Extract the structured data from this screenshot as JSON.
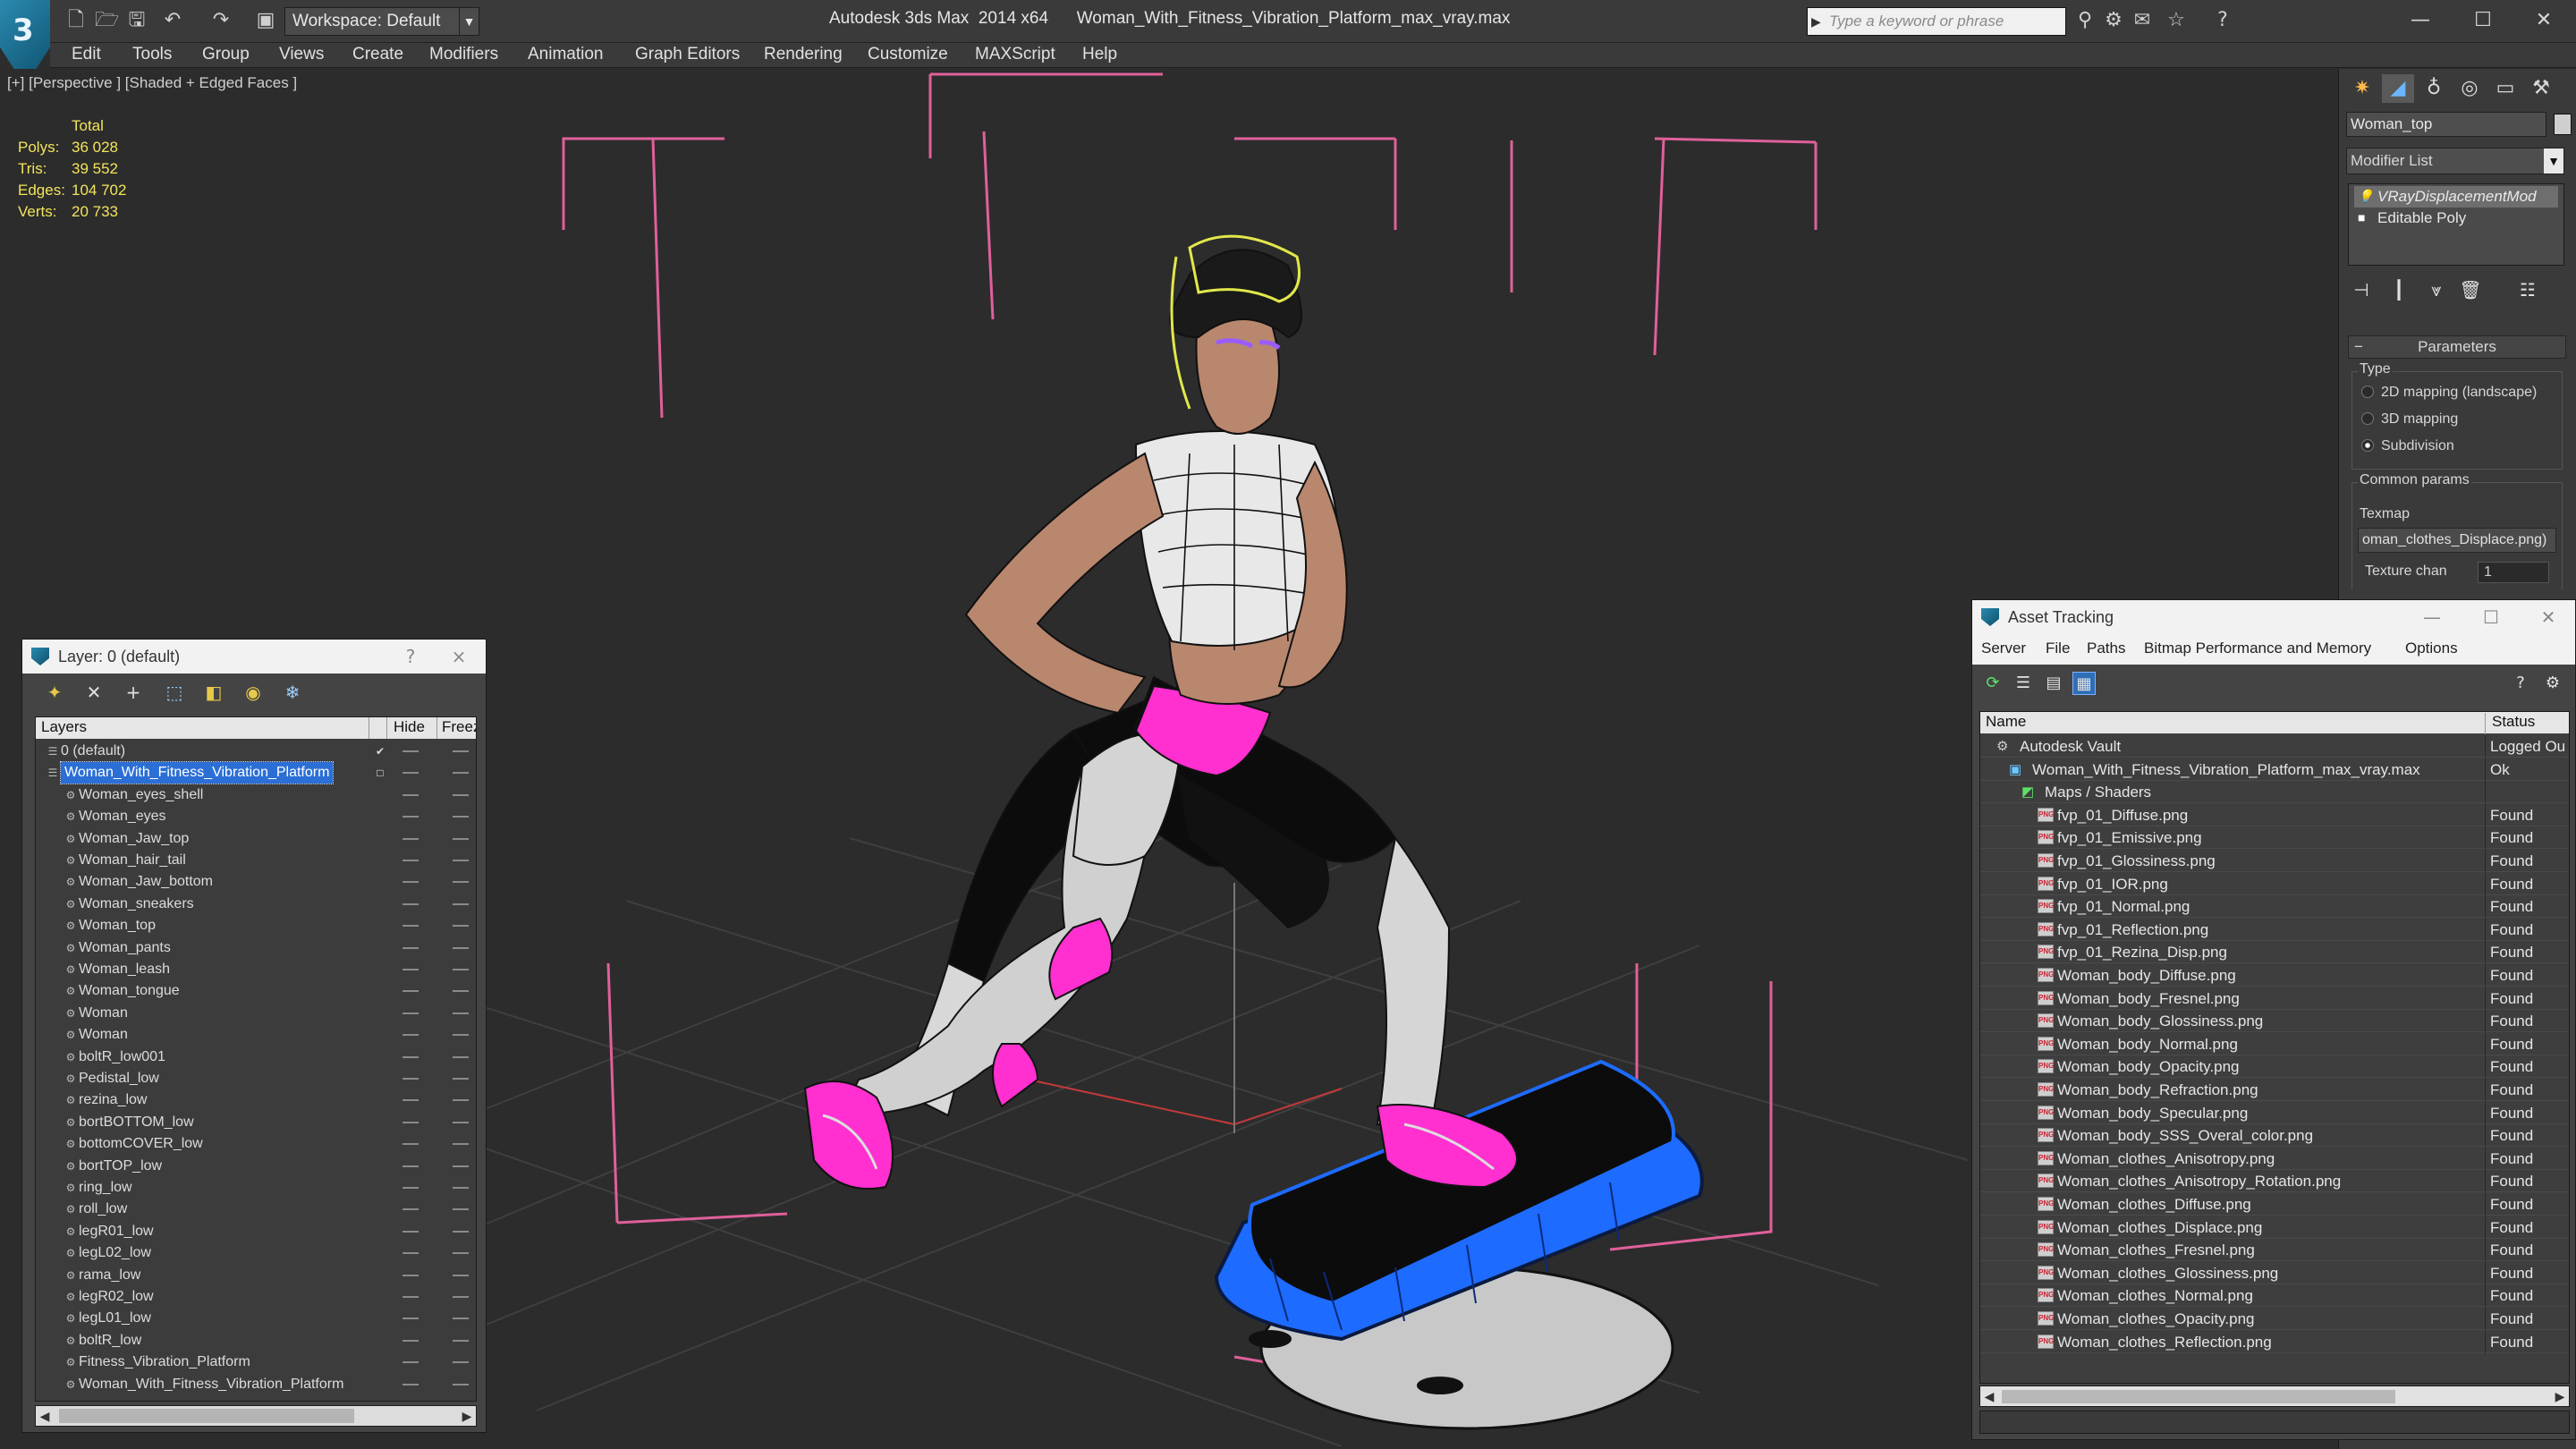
{
  "titlebar": {
    "workspace_label": "Workspace: Default",
    "app_title": "Autodesk 3ds Max  2014 x64      Woman_With_Fitness_Vibration_Platform_max_vray.max",
    "search_placeholder": "Type a keyword or phrase"
  },
  "menu": [
    "Edit",
    "Tools",
    "Group",
    "Views",
    "Create",
    "Modifiers",
    "Animation",
    "Graph Editors",
    "Rendering",
    "Customize",
    "MAXScript",
    "Help"
  ],
  "viewport": {
    "label": "[+] [Perspective ] [Shaded + Edged Faces ]",
    "stats": {
      "header": "Total",
      "polys_label": "Polys:",
      "polys": "36 028",
      "tris_label": "Tris:",
      "tris": "39 552",
      "edges_label": "Edges:",
      "edges": "104 702",
      "verts_label": "Verts:",
      "verts": "20 733"
    }
  },
  "command_panel": {
    "object_name": "Woman_top",
    "modifier_list": "Modifier List",
    "stack": [
      "VRayDisplacementMod",
      "Editable Poly"
    ],
    "parameters_title": "Parameters",
    "type_group": "Type",
    "type_options": [
      "2D mapping (landscape)",
      "3D mapping",
      "Subdivision"
    ],
    "type_selected": 2,
    "common_group": "Common params",
    "texmap_label": "Texmap",
    "texmap_value": "oman_clothes_Displace.png)",
    "texture_chan_label": "Texture chan",
    "texture_chan_value": "1"
  },
  "layer_window": {
    "title": "Layer: 0 (default)",
    "help": "?",
    "close": "×",
    "col_layers": "Layers",
    "col_hide": "Hide",
    "col_freeze": "Freez",
    "layers": [
      {
        "name": "0 (default)",
        "level": 0,
        "checked": true
      },
      {
        "name": "Woman_With_Fitness_Vibration_Platform",
        "level": 0,
        "selected": true
      },
      {
        "name": "Woman_eyes_shell",
        "level": 1
      },
      {
        "name": "Woman_eyes",
        "level": 1
      },
      {
        "name": "Woman_Jaw_top",
        "level": 1
      },
      {
        "name": "Woman_hair_tail",
        "level": 1
      },
      {
        "name": "Woman_Jaw_bottom",
        "level": 1
      },
      {
        "name": "Woman_sneakers",
        "level": 1
      },
      {
        "name": "Woman_top",
        "level": 1
      },
      {
        "name": "Woman_pants",
        "level": 1
      },
      {
        "name": "Woman_leash",
        "level": 1
      },
      {
        "name": "Woman_tongue",
        "level": 1
      },
      {
        "name": "Woman",
        "level": 1
      },
      {
        "name": "Woman",
        "level": 1
      },
      {
        "name": "boltR_low001",
        "level": 1
      },
      {
        "name": "Pedistal_low",
        "level": 1
      },
      {
        "name": "rezina_low",
        "level": 1
      },
      {
        "name": "bortBOTTOM_low",
        "level": 1
      },
      {
        "name": "bottomCOVER_low",
        "level": 1
      },
      {
        "name": "bortTOP_low",
        "level": 1
      },
      {
        "name": "ring_low",
        "level": 1
      },
      {
        "name": "roll_low",
        "level": 1
      },
      {
        "name": "legR01_low",
        "level": 1
      },
      {
        "name": "legL02_low",
        "level": 1
      },
      {
        "name": "rama_low",
        "level": 1
      },
      {
        "name": "legR02_low",
        "level": 1
      },
      {
        "name": "legL01_low",
        "level": 1
      },
      {
        "name": "boltR_low",
        "level": 1
      },
      {
        "name": "Fitness_Vibration_Platform",
        "level": 1
      },
      {
        "name": "Woman_With_Fitness_Vibration_Platform",
        "level": 1
      }
    ]
  },
  "asset_window": {
    "title": "Asset Tracking",
    "menu": [
      "Server",
      "File",
      "Paths",
      "Bitmap Performance and Memory",
      "Options"
    ],
    "col_name": "Name",
    "col_status": "Status",
    "assets": [
      {
        "name": "Autodesk Vault",
        "status": "Logged Ou",
        "level": 0,
        "kind": "vault"
      },
      {
        "name": "Woman_With_Fitness_Vibration_Platform_max_vray.max",
        "status": "Ok",
        "level": 1,
        "kind": "max"
      },
      {
        "name": "Maps / Shaders",
        "status": "",
        "level": 2,
        "kind": "folder"
      },
      {
        "name": "fvp_01_Diffuse.png",
        "status": "Found",
        "level": 3,
        "kind": "png"
      },
      {
        "name": "fvp_01_Emissive.png",
        "status": "Found",
        "level": 3,
        "kind": "png"
      },
      {
        "name": "fvp_01_Glossiness.png",
        "status": "Found",
        "level": 3,
        "kind": "png"
      },
      {
        "name": "fvp_01_IOR.png",
        "status": "Found",
        "level": 3,
        "kind": "png"
      },
      {
        "name": "fvp_01_Normal.png",
        "status": "Found",
        "level": 3,
        "kind": "png"
      },
      {
        "name": "fvp_01_Reflection.png",
        "status": "Found",
        "level": 3,
        "kind": "png"
      },
      {
        "name": "fvp_01_Rezina_Disp.png",
        "status": "Found",
        "level": 3,
        "kind": "png"
      },
      {
        "name": "Woman_body_Diffuse.png",
        "status": "Found",
        "level": 3,
        "kind": "png"
      },
      {
        "name": "Woman_body_Fresnel.png",
        "status": "Found",
        "level": 3,
        "kind": "png"
      },
      {
        "name": "Woman_body_Glossiness.png",
        "status": "Found",
        "level": 3,
        "kind": "png"
      },
      {
        "name": "Woman_body_Normal.png",
        "status": "Found",
        "level": 3,
        "kind": "png"
      },
      {
        "name": "Woman_body_Opacity.png",
        "status": "Found",
        "level": 3,
        "kind": "png"
      },
      {
        "name": "Woman_body_Refraction.png",
        "status": "Found",
        "level": 3,
        "kind": "png"
      },
      {
        "name": "Woman_body_Specular.png",
        "status": "Found",
        "level": 3,
        "kind": "png"
      },
      {
        "name": "Woman_body_SSS_Overal_color.png",
        "status": "Found",
        "level": 3,
        "kind": "png"
      },
      {
        "name": "Woman_clothes_Anisotropy.png",
        "status": "Found",
        "level": 3,
        "kind": "png"
      },
      {
        "name": "Woman_clothes_Anisotropy_Rotation.png",
        "status": "Found",
        "level": 3,
        "kind": "png"
      },
      {
        "name": "Woman_clothes_Diffuse.png",
        "status": "Found",
        "level": 3,
        "kind": "png"
      },
      {
        "name": "Woman_clothes_Displace.png",
        "status": "Found",
        "level": 3,
        "kind": "png"
      },
      {
        "name": "Woman_clothes_Fresnel.png",
        "status": "Found",
        "level": 3,
        "kind": "png"
      },
      {
        "name": "Woman_clothes_Glossiness.png",
        "status": "Found",
        "level": 3,
        "kind": "png"
      },
      {
        "name": "Woman_clothes_Normal.png",
        "status": "Found",
        "level": 3,
        "kind": "png"
      },
      {
        "name": "Woman_clothes_Opacity.png",
        "status": "Found",
        "level": 3,
        "kind": "png"
      },
      {
        "name": "Woman_clothes_Reflection.png",
        "status": "Found",
        "level": 3,
        "kind": "png"
      }
    ]
  },
  "colors": {
    "selection_bbox": "#e0609a",
    "highlight_magenta": "#ff2fd0",
    "platform_blue": "#1e6bff",
    "stats_yellow": "#f2e45a",
    "selection_blue": "#2b6fd6"
  }
}
